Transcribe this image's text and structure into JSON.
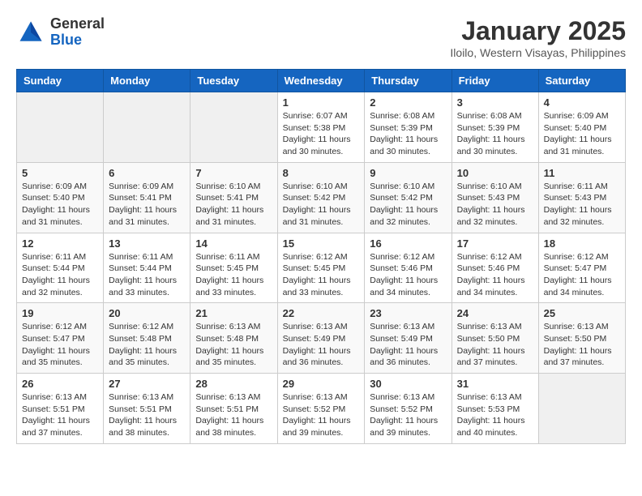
{
  "logo": {
    "general": "General",
    "blue": "Blue"
  },
  "title": "January 2025",
  "subtitle": "Iloilo, Western Visayas, Philippines",
  "days_header": [
    "Sunday",
    "Monday",
    "Tuesday",
    "Wednesday",
    "Thursday",
    "Friday",
    "Saturday"
  ],
  "weeks": [
    [
      {
        "day": "",
        "info": ""
      },
      {
        "day": "",
        "info": ""
      },
      {
        "day": "",
        "info": ""
      },
      {
        "day": "1",
        "info": "Sunrise: 6:07 AM\nSunset: 5:38 PM\nDaylight: 11 hours and 30 minutes."
      },
      {
        "day": "2",
        "info": "Sunrise: 6:08 AM\nSunset: 5:39 PM\nDaylight: 11 hours and 30 minutes."
      },
      {
        "day": "3",
        "info": "Sunrise: 6:08 AM\nSunset: 5:39 PM\nDaylight: 11 hours and 30 minutes."
      },
      {
        "day": "4",
        "info": "Sunrise: 6:09 AM\nSunset: 5:40 PM\nDaylight: 11 hours and 31 minutes."
      }
    ],
    [
      {
        "day": "5",
        "info": "Sunrise: 6:09 AM\nSunset: 5:40 PM\nDaylight: 11 hours and 31 minutes."
      },
      {
        "day": "6",
        "info": "Sunrise: 6:09 AM\nSunset: 5:41 PM\nDaylight: 11 hours and 31 minutes."
      },
      {
        "day": "7",
        "info": "Sunrise: 6:10 AM\nSunset: 5:41 PM\nDaylight: 11 hours and 31 minutes."
      },
      {
        "day": "8",
        "info": "Sunrise: 6:10 AM\nSunset: 5:42 PM\nDaylight: 11 hours and 31 minutes."
      },
      {
        "day": "9",
        "info": "Sunrise: 6:10 AM\nSunset: 5:42 PM\nDaylight: 11 hours and 32 minutes."
      },
      {
        "day": "10",
        "info": "Sunrise: 6:10 AM\nSunset: 5:43 PM\nDaylight: 11 hours and 32 minutes."
      },
      {
        "day": "11",
        "info": "Sunrise: 6:11 AM\nSunset: 5:43 PM\nDaylight: 11 hours and 32 minutes."
      }
    ],
    [
      {
        "day": "12",
        "info": "Sunrise: 6:11 AM\nSunset: 5:44 PM\nDaylight: 11 hours and 32 minutes."
      },
      {
        "day": "13",
        "info": "Sunrise: 6:11 AM\nSunset: 5:44 PM\nDaylight: 11 hours and 33 minutes."
      },
      {
        "day": "14",
        "info": "Sunrise: 6:11 AM\nSunset: 5:45 PM\nDaylight: 11 hours and 33 minutes."
      },
      {
        "day": "15",
        "info": "Sunrise: 6:12 AM\nSunset: 5:45 PM\nDaylight: 11 hours and 33 minutes."
      },
      {
        "day": "16",
        "info": "Sunrise: 6:12 AM\nSunset: 5:46 PM\nDaylight: 11 hours and 34 minutes."
      },
      {
        "day": "17",
        "info": "Sunrise: 6:12 AM\nSunset: 5:46 PM\nDaylight: 11 hours and 34 minutes."
      },
      {
        "day": "18",
        "info": "Sunrise: 6:12 AM\nSunset: 5:47 PM\nDaylight: 11 hours and 34 minutes."
      }
    ],
    [
      {
        "day": "19",
        "info": "Sunrise: 6:12 AM\nSunset: 5:47 PM\nDaylight: 11 hours and 35 minutes."
      },
      {
        "day": "20",
        "info": "Sunrise: 6:12 AM\nSunset: 5:48 PM\nDaylight: 11 hours and 35 minutes."
      },
      {
        "day": "21",
        "info": "Sunrise: 6:13 AM\nSunset: 5:48 PM\nDaylight: 11 hours and 35 minutes."
      },
      {
        "day": "22",
        "info": "Sunrise: 6:13 AM\nSunset: 5:49 PM\nDaylight: 11 hours and 36 minutes."
      },
      {
        "day": "23",
        "info": "Sunrise: 6:13 AM\nSunset: 5:49 PM\nDaylight: 11 hours and 36 minutes."
      },
      {
        "day": "24",
        "info": "Sunrise: 6:13 AM\nSunset: 5:50 PM\nDaylight: 11 hours and 37 minutes."
      },
      {
        "day": "25",
        "info": "Sunrise: 6:13 AM\nSunset: 5:50 PM\nDaylight: 11 hours and 37 minutes."
      }
    ],
    [
      {
        "day": "26",
        "info": "Sunrise: 6:13 AM\nSunset: 5:51 PM\nDaylight: 11 hours and 37 minutes."
      },
      {
        "day": "27",
        "info": "Sunrise: 6:13 AM\nSunset: 5:51 PM\nDaylight: 11 hours and 38 minutes."
      },
      {
        "day": "28",
        "info": "Sunrise: 6:13 AM\nSunset: 5:51 PM\nDaylight: 11 hours and 38 minutes."
      },
      {
        "day": "29",
        "info": "Sunrise: 6:13 AM\nSunset: 5:52 PM\nDaylight: 11 hours and 39 minutes."
      },
      {
        "day": "30",
        "info": "Sunrise: 6:13 AM\nSunset: 5:52 PM\nDaylight: 11 hours and 39 minutes."
      },
      {
        "day": "31",
        "info": "Sunrise: 6:13 AM\nSunset: 5:53 PM\nDaylight: 11 hours and 40 minutes."
      },
      {
        "day": "",
        "info": ""
      }
    ]
  ]
}
